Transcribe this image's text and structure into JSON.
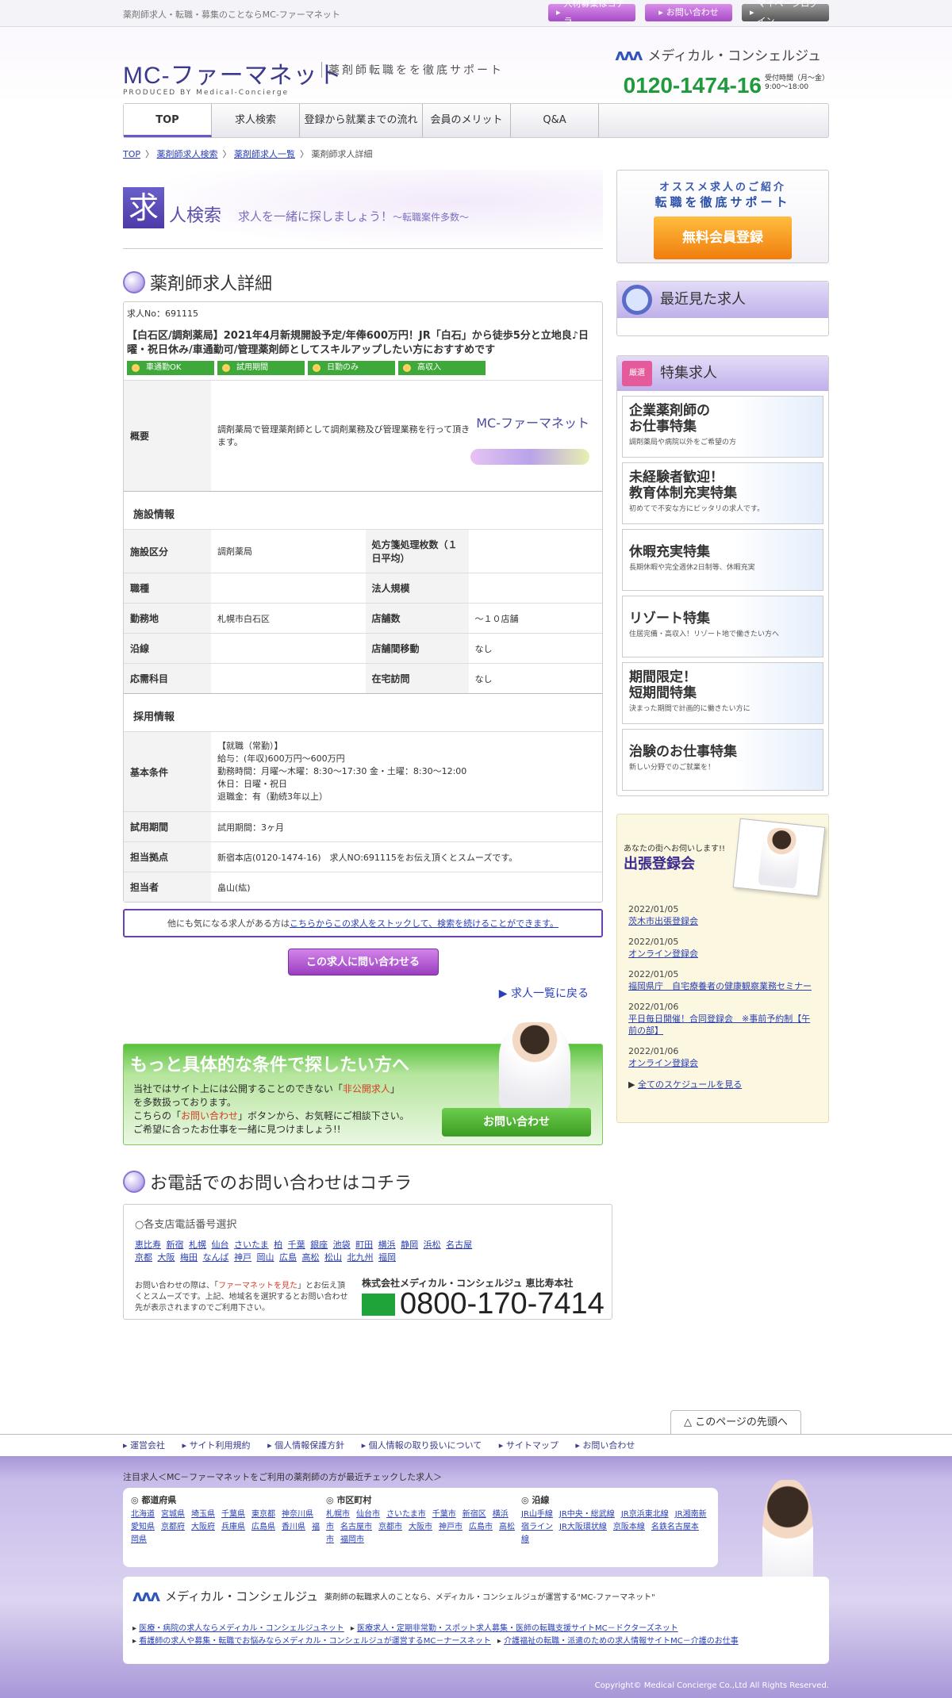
{
  "topbar": {
    "tagline": "薬剤師求人・転職・募集のことならMC-ファーマネット",
    "btn_recruit": "人材募集はコチラ",
    "btn_contact": "お問い合わせ",
    "btn_login": "マイページログイン"
  },
  "header": {
    "logo": "MC-ファーマネット",
    "produced": "PRODUCED BY Medical-Concierge",
    "slogan": "薬剤師転職をを徹底サポート",
    "company": "メディカル・コンシェルジュ",
    "tel": "0120-1474-16",
    "hours1": "受付時間（月～金）",
    "hours2": "9:00～18:00"
  },
  "nav": [
    "TOP",
    "求人検索",
    "登録から就業までの流れ",
    "会員のメリット",
    "Q&A"
  ],
  "breadcrumb": {
    "home": "TOP",
    "search": "薬剤師求人検索",
    "list": "薬剤師求人一覧",
    "current": "薬剤師求人詳細"
  },
  "search_head": {
    "kanji": "求",
    "title": "人検索",
    "sub": "求人を一緒に探しましょう！",
    "sub2": "～転職案件多数～"
  },
  "detail": {
    "heading": "薬剤師求人詳細",
    "job_no": "求人No：691115",
    "title": "【白石区/調剤薬局】2021年4月新規開設予定/年俸600万円！JR「白石」から徒歩5分と立地良♪日曜・祝日休み/車通勤可/管理薬剤師としてスキルアップしたい方におすすめです",
    "badges": [
      "車通勤OK",
      "試用期間",
      "日勤のみ",
      "高収入"
    ],
    "overview_label": "概要",
    "overview": "調剤薬局で管理薬剤師として調剤業務及び管理業務を行って頂きます。",
    "facility_label": "施設情報",
    "facility": [
      {
        "l1": "施設区分",
        "v1": "調剤薬局",
        "l2": "処方箋処理枚数（１日平均）",
        "v2": ""
      },
      {
        "l1": "職種",
        "v1": "",
        "l2": "法人規模",
        "v2": ""
      },
      {
        "l1": "勤務地",
        "v1": "札幌市白石区",
        "l2": "店舗数",
        "v2": "～１０店舗"
      },
      {
        "l1": "沿線",
        "v1": "",
        "l2": "店舗間移動",
        "v2": "なし"
      },
      {
        "l1": "応需科目",
        "v1": "",
        "l2": "在宅訪問",
        "v2": "なし"
      }
    ],
    "recruit_label": "採用情報",
    "conditions_label": "基本条件",
    "conditions": [
      "【就職（常勤）】",
      "給与：(年収)600万円～600万円",
      "勤務時間：月曜～木曜：8:30～17:30 金・土曜：8:30～12:00",
      "休日：日曜・祝日",
      "退職金：有（勤続3年以上）"
    ],
    "trial_label": "試用期間",
    "trial": "試用期間：3ヶ月",
    "branch_label": "担当拠点",
    "branch": "新宿本店(0120-1474-16)　求人NO:691115をお伝え頂くとスムーズです。",
    "staff_label": "担当者",
    "staff": "畠山(紘)",
    "other_text": "他にも気になる求人がある方は",
    "other_link": "こちらからこの求人をストックして、検索を続けることができます。",
    "ask_button": "この求人に問い合わせる",
    "back_link": "求人一覧に戻る"
  },
  "promo": {
    "title": "もっと具体的な条件で探したい方へ",
    "l1a": "当社ではサイト上には公開することのできない「",
    "l1b": "非公開求人",
    "l1c": "」",
    "l2": "を多数扱っております。",
    "l3a": "こちらの「",
    "l3b": "お問い合わせ",
    "l3c": "」ボタンから、お気軽にご相談下さい。",
    "l4": "ご希望に合ったお仕事を一緒に見つけましょう!!",
    "button": "お問い合わせ"
  },
  "phone": {
    "heading": "お電話でのお問い合わせはコチラ",
    "select": "○各支店電話番号選択",
    "cities": [
      "恵比寿",
      "新宿",
      "札幌",
      "仙台",
      "さいたま",
      "柏",
      "千葉",
      "銀座",
      "池袋",
      "町田",
      "横浜",
      "静岡",
      "浜松",
      "名古屋",
      "京都",
      "大阪",
      "梅田",
      "なんば",
      "神戸",
      "岡山",
      "広島",
      "高松",
      "松山",
      "北九州",
      "福岡"
    ],
    "note_a": "お問い合わせの際は、「",
    "note_b": "ファーマネットを見た",
    "note_c": "」とお伝え頂くとスムーズです。上記、地域名を選択するとお問い合わせ先が表示されますのでご利用下さい。",
    "corp": "株式会社メディカル・コンシェルジュ 恵比寿本社",
    "number": "0800-170-7414"
  },
  "side": {
    "reco_l1": "オススメ求人のご紹介",
    "reco_l2": "転職を徹底サポート",
    "reco_button": "無料会員登録",
    "recent": "最近見た求人",
    "tokushu": "特集求人",
    "tokushu_tag": "厳選",
    "cards": [
      {
        "h1": "企業薬剤師の",
        "h2": "お仕事特集",
        "s": "調剤薬局や病院以外をご希望の方"
      },
      {
        "h1": "未経験者歓迎！",
        "h2": "教育体制充実特集",
        "s": "初めてで不安な方にピッタリの求人です。"
      },
      {
        "h1": "休暇充実特集",
        "h2": "",
        "s": "長期休暇や完全週休2日制等、休暇充実"
      },
      {
        "h1": "リゾート特集",
        "h2": "",
        "s": "住居完備・高収入！リゾート地で働きたい方へ"
      },
      {
        "h1": "期間限定！",
        "h2": "短期間特集",
        "s": "決まった期間で計画的に働きたい方に"
      },
      {
        "h1": "治験のお仕事特集",
        "h2": "",
        "s": "新しい分野でのご就業を！"
      }
    ],
    "shucho_sub": "あなたの街へお伺いします!!",
    "shucho_title": "出張登録会",
    "schedule": [
      {
        "date": "2022/01/05",
        "text": "茨木市出張登録会"
      },
      {
        "date": "2022/01/05",
        "text": "オンライン登録会"
      },
      {
        "date": "2022/01/05",
        "text": "福岡県庁　自宅療養者の健康観察業務セミナー"
      },
      {
        "date": "2022/01/06",
        "text": "平日毎日開催！合同登録会　※事前予約制【午前の部】"
      },
      {
        "date": "2022/01/06",
        "text": "オンライン登録会"
      }
    ],
    "all_schedule": "全てのスケジュールを見る"
  },
  "footer": {
    "pagetop": "このページの先頭へ",
    "links": [
      "運営会社",
      "サイト利用規約",
      "個人情報保護方針",
      "個人情報の取り扱いについて",
      "サイトマップ",
      "お問い合わせ"
    ],
    "attention": "注目求人＜MC－ファーマネットをご利用の薬剤師の方が最近チェックした求人＞",
    "pref_h": "都道府県",
    "prefs": [
      "北海道",
      "宮城県",
      "埼玉県",
      "千葉県",
      "東京都",
      "神奈川県",
      "愛知県",
      "京都府",
      "大阪府",
      "兵庫県",
      "広島県",
      "香川県",
      "福岡県"
    ],
    "city_h": "市区町村",
    "cities": [
      "札幌市",
      "仙台市",
      "さいたま市",
      "千葉市",
      "新宿区",
      "横浜市",
      "名古屋市",
      "京都市",
      "大阪市",
      "神戸市",
      "広島市",
      "高松市",
      "福岡市"
    ],
    "line_h": "沿線",
    "lines": [
      "JR山手線",
      "JR中央・総武線",
      "JR京浜東北線",
      "JR湘南新宿ライン",
      "JR大阪環状線",
      "京阪本線",
      "名鉄名古屋本線"
    ],
    "company": "メディカル・コンシェルジュ",
    "company_desc": "薬剤師の転職求人のことなら、メディカル・コンシェルジュが運営する\"MC-ファーマネット\"",
    "related": [
      "医療・病院の求人ならメディカル・コンシェルジュネット",
      "医療求人・定期非常勤・スポット求人募集・医師の転職支援サイトMC－ドクターズネット",
      "看護師の求人や募集・転職でお悩みならメディカル・コンシェルジュが運営するMC－ナースネット",
      "介護福祉の転職・派遣のための求人情報サイトMC－介護のお仕事"
    ],
    "copyright": "Copyright© Medical Concierge Co.,Ltd All Rights Reserved."
  },
  "colors": {
    "purple": "#6d59c6",
    "green": "#1f9a3c",
    "orange": "#f07d0e"
  }
}
